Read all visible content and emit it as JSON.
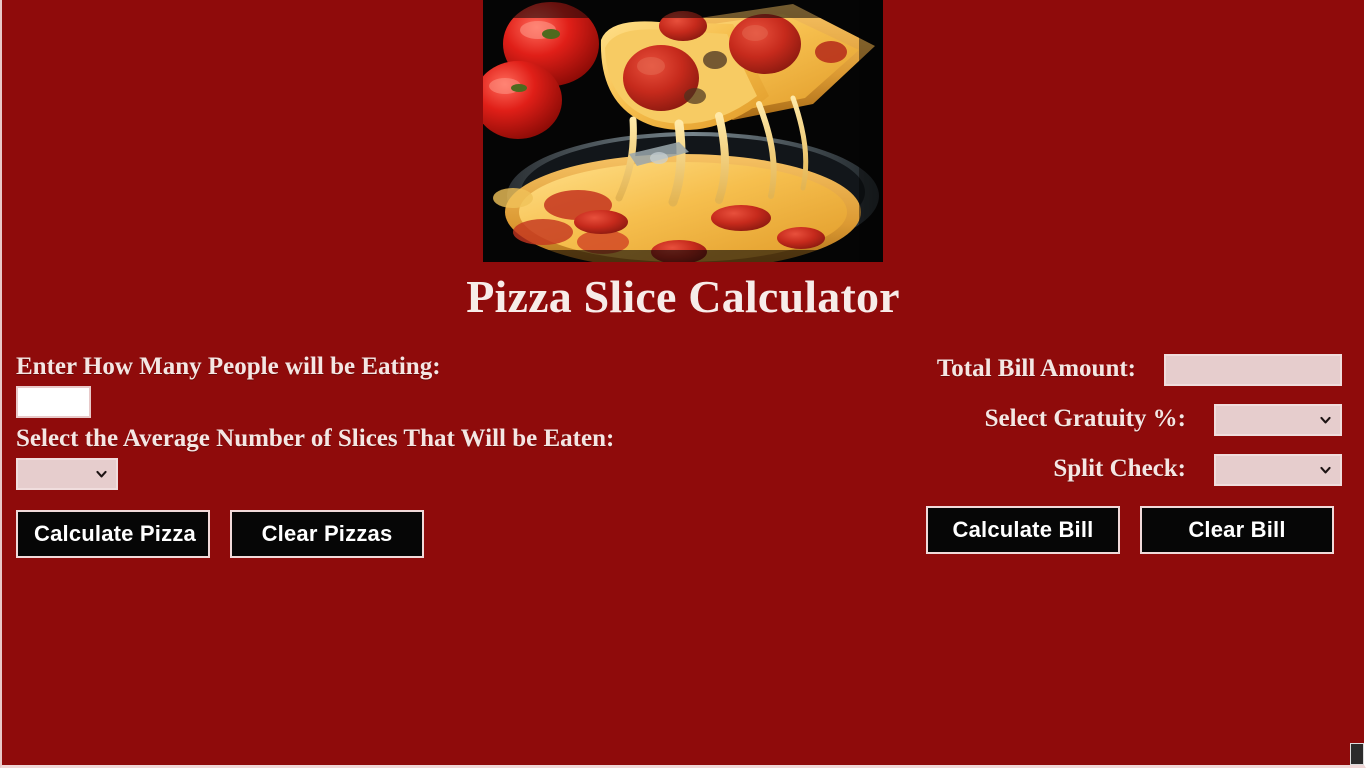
{
  "page": {
    "title": "Pizza Slice Calculator",
    "background_color": "#8f0b0b",
    "accent_color": "#e6cdcd",
    "text_color": "#f4e6e3"
  },
  "hero": {
    "image_alt": "pepperoni-pizza-slice-being-lifted-with-cheese-pull-and-tomatoes",
    "heading": "Pizza Slice Calculator"
  },
  "pizza_form": {
    "people_label": "Enter How Many People will be Eating:",
    "people_value": "",
    "people_placeholder": "",
    "slices_label": "Select the Average Number of Slices That Will be Eaten:",
    "slices_value": "",
    "calculate_label": "Calculate Pizza",
    "clear_label": "Clear Pizzas"
  },
  "bill_form": {
    "total_label": "Total Bill Amount:",
    "total_value": "",
    "total_placeholder": "",
    "gratuity_label": "Select Gratuity %:",
    "gratuity_value": "",
    "split_label": "Split Check:",
    "split_value": "",
    "calculate_label": "Calculate Bill",
    "clear_label": "Clear Bill"
  }
}
